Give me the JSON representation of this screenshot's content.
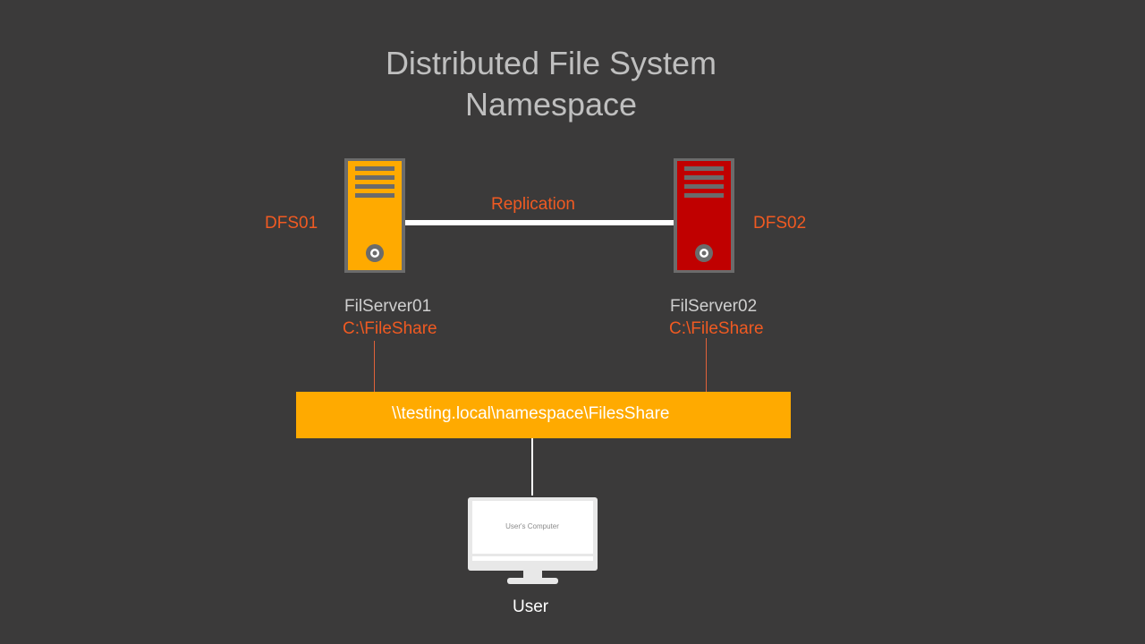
{
  "title": {
    "line1": "Distributed File System",
    "line2": "Namespace"
  },
  "servers": [
    {
      "dfs_label": "DFS01",
      "name": "FilServer01",
      "path": "C:\\FileShare",
      "color": "#ffaa00"
    },
    {
      "dfs_label": "DFS02",
      "name": "FilServer02",
      "path": "C:\\FileShare",
      "color": "#c00000"
    }
  ],
  "replication_label": "Replication",
  "namespace_path": "\\\\testing.local\\namespace\\FilesShare",
  "computer": {
    "screen_text": "User's Computer",
    "user_label": "User"
  },
  "colors": {
    "background": "#3b3a3a",
    "accent_text": "#f05a22",
    "namespace_bar": "#ffaa00"
  }
}
